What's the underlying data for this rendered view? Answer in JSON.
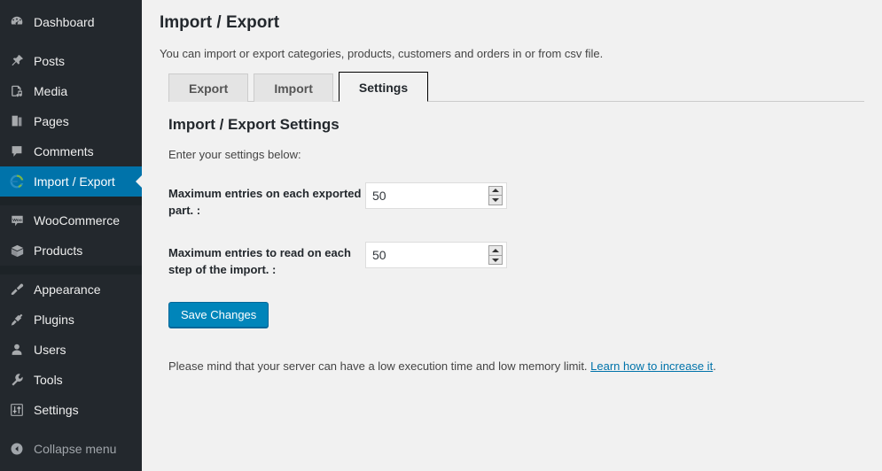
{
  "sidebar": {
    "groups": [
      {
        "items": [
          {
            "label": "Dashboard",
            "icon": "dashboard-icon",
            "active": false
          }
        ]
      },
      {
        "items": [
          {
            "label": "Posts",
            "icon": "pin-icon",
            "active": false
          },
          {
            "label": "Media",
            "icon": "media-icon",
            "active": false
          },
          {
            "label": "Pages",
            "icon": "pages-icon",
            "active": false
          },
          {
            "label": "Comments",
            "icon": "comment-icon",
            "active": false
          },
          {
            "label": "Import / Export",
            "icon": "sync-icon",
            "active": true
          }
        ]
      },
      {
        "items": [
          {
            "label": "WooCommerce",
            "icon": "woocommerce-icon",
            "active": false
          },
          {
            "label": "Products",
            "icon": "products-box-icon",
            "active": false
          }
        ]
      },
      {
        "items": [
          {
            "label": "Appearance",
            "icon": "appearance-brush-icon",
            "active": false
          },
          {
            "label": "Plugins",
            "icon": "plug-icon",
            "active": false
          },
          {
            "label": "Users",
            "icon": "user-icon",
            "active": false
          },
          {
            "label": "Tools",
            "icon": "wrench-icon",
            "active": false
          },
          {
            "label": "Settings",
            "icon": "sliders-icon",
            "active": false
          }
        ]
      }
    ],
    "collapse": {
      "label": "Collapse menu",
      "icon": "collapse-left-arrow-icon"
    },
    "colors": {
      "background": "#23282d",
      "active": "#0073aa",
      "text": "#eeeeee",
      "muted": "#a0a5aa"
    }
  },
  "main": {
    "title": "Import / Export",
    "intro": "You can import or export categories, products, customers and orders in or from csv file.",
    "tabs": [
      {
        "label": "Export",
        "active": false
      },
      {
        "label": "Import",
        "active": false
      },
      {
        "label": "Settings",
        "active": true
      }
    ],
    "settings": {
      "heading": "Import / Export Settings",
      "hint": "Enter your settings below:",
      "fields": [
        {
          "label": "Maximum entries on each exported part. :",
          "value": "50",
          "placeholder": ""
        },
        {
          "label": "Maximum entries to read on each step of the import. :",
          "value": "50",
          "placeholder": ""
        }
      ],
      "save_label": "Save Changes",
      "footnote_text": "Please mind that your server can have a low execution time and low memory limit. ",
      "footnote_link": "Learn how to increase it",
      "footnote_tail": "."
    },
    "colors": {
      "background": "#f1f1f1",
      "button": "#0085ba",
      "link": "#0073aa"
    }
  }
}
